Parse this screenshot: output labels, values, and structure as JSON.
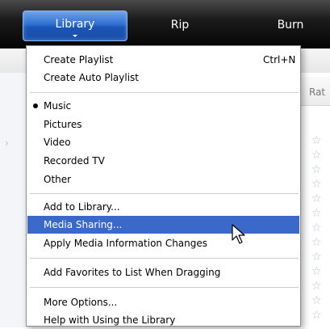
{
  "toolbar": {
    "tabs": [
      {
        "label": "Library"
      },
      {
        "label": "Rip"
      },
      {
        "label": "Burn"
      }
    ]
  },
  "background": {
    "rating_header": "Rat"
  },
  "menu": {
    "items": [
      {
        "label": "Create Playlist",
        "shortcut": "Ctrl+N"
      },
      {
        "label": "Create Auto Playlist"
      },
      {
        "label": "Music",
        "checked": true
      },
      {
        "label": "Pictures"
      },
      {
        "label": "Video"
      },
      {
        "label": "Recorded TV"
      },
      {
        "label": "Other"
      },
      {
        "label": "Add to Library..."
      },
      {
        "label": "Media Sharing..."
      },
      {
        "label": "Apply Media Information Changes"
      },
      {
        "label": "Add Favorites to List When Dragging"
      },
      {
        "label": "More Options..."
      },
      {
        "label": "Help with Using the Library"
      }
    ],
    "highlight_color": "#3a69c9"
  }
}
